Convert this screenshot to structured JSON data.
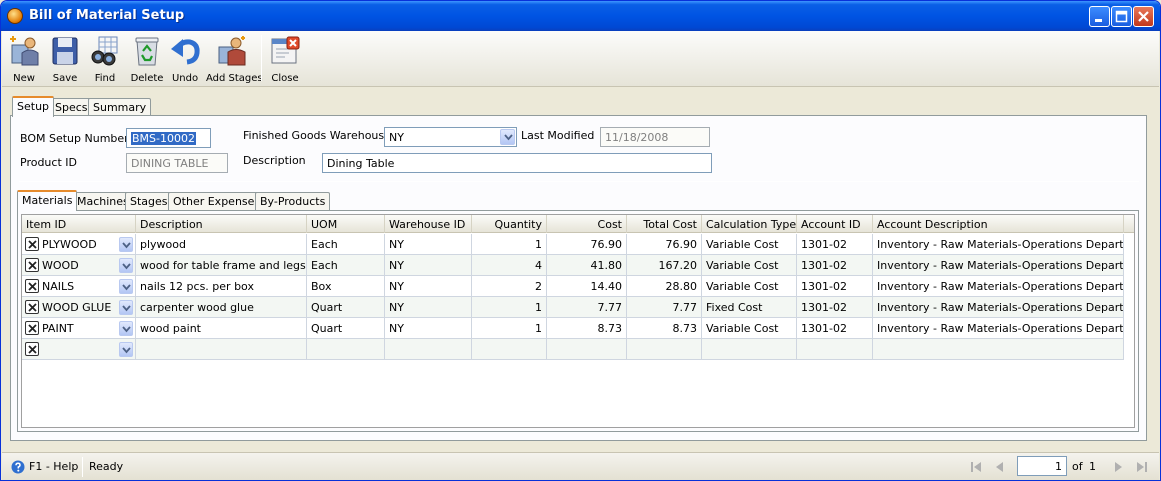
{
  "window": {
    "title": "Bill of Material Setup"
  },
  "toolbar": {
    "new_label": "New",
    "save_label": "Save",
    "find_label": "Find",
    "delete_label": "Delete",
    "undo_label": "Undo",
    "add_stages_label": "Add Stages",
    "close_label": "Close"
  },
  "tabs": {
    "setup": "Setup",
    "specs": "Specs",
    "summary": "Summary"
  },
  "form": {
    "bom_label": "BOM Setup Number",
    "bom_value": "BMS-10002",
    "fg_label": "Finished Goods Warehouse",
    "fg_value": "NY",
    "lm_label": "Last Modified",
    "lm_value": "11/18/2008",
    "pid_label": "Product ID",
    "pid_value": "DINING TABLE",
    "desc_label": "Description",
    "desc_value": "Dining Table"
  },
  "subtabs": {
    "materials": "Materials",
    "machines": "Machines",
    "stages": "Stages",
    "other": "Other Expenses",
    "byproducts": "By-Products"
  },
  "grid": {
    "columns": [
      "Item ID",
      "Description",
      "UOM",
      "Warehouse ID",
      "Quantity",
      "Cost",
      "Total Cost",
      "Calculation Type",
      "Account ID",
      "Account Description"
    ],
    "rows": [
      [
        "PLYWOOD",
        "plywood",
        "Each",
        "NY",
        "1",
        "76.90",
        "76.90",
        "Variable Cost",
        "1301-02",
        "Inventory - Raw Materials-Operations Department"
      ],
      [
        "WOOD",
        "wood for table frame and legs",
        "Each",
        "NY",
        "4",
        "41.80",
        "167.20",
        "Variable Cost",
        "1301-02",
        "Inventory - Raw Materials-Operations Department"
      ],
      [
        "NAILS",
        "nails 12 pcs. per box",
        "Box",
        "NY",
        "2",
        "14.40",
        "28.80",
        "Variable Cost",
        "1301-02",
        "Inventory - Raw Materials-Operations Department"
      ],
      [
        "WOOD GLUE",
        "carpenter wood glue",
        "Quart",
        "NY",
        "1",
        "7.77",
        "7.77",
        "Fixed Cost",
        "1301-02",
        "Inventory - Raw Materials-Operations Department"
      ],
      [
        "PAINT",
        "wood paint",
        "Quart",
        "NY",
        "1",
        "8.73",
        "8.73",
        "Variable Cost",
        "1301-02",
        "Inventory - Raw Materials-Operations Department"
      ],
      [
        "",
        "",
        "",
        "",
        "",
        "",
        "",
        "",
        "",
        ""
      ]
    ]
  },
  "status": {
    "help": "F1 - Help",
    "ready": "Ready",
    "page_value": "1",
    "page_of": "of",
    "page_total": "1"
  },
  "icons": {
    "title": "app-icon",
    "new": "new-icon",
    "save": "save-disk-icon",
    "find": "binoculars-icon",
    "delete": "recycle-bin-icon",
    "undo": "undo-arrow-icon",
    "add_stages": "add-stages-icon",
    "close": "close-window-icon"
  },
  "colors": {
    "titlebar": "#0054e3",
    "active_tab_accent": "#e68b2c",
    "selection": "#316ac5"
  }
}
